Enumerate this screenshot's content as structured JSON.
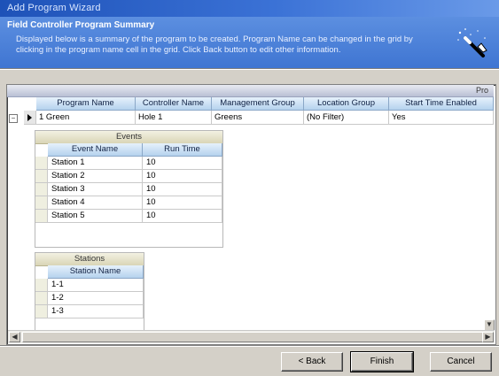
{
  "window": {
    "title": "Add Program Wizard"
  },
  "header": {
    "title": "Field Controller Program Summary",
    "description": "Displayed below is a summary of the program to be created.  Program Name can be changed in the grid by clicking in the program name cell in the grid.  Click Back button to edit other information.",
    "icon": "magic-wand-icon"
  },
  "grid": {
    "group_label": "Pro",
    "columns": [
      "Program Name",
      "Controller Name",
      "Management Group",
      "Location Group",
      "Start Time Enabled"
    ],
    "rows": [
      {
        "program": "1 Green",
        "controller": "Hole 1",
        "management": "Greens",
        "location": "(No Filter)",
        "start_time": "Yes"
      }
    ],
    "events": {
      "title": "Events",
      "columns": [
        "Event Name",
        "Run Time"
      ],
      "rows": [
        {
          "name": "Station 1",
          "run_time": "10"
        },
        {
          "name": "Station 2",
          "run_time": "10"
        },
        {
          "name": "Station 3",
          "run_time": "10"
        },
        {
          "name": "Station 4",
          "run_time": "10"
        },
        {
          "name": "Station 5",
          "run_time": "10"
        }
      ]
    },
    "stations": {
      "title": "Stations",
      "columns": [
        "Station Name"
      ],
      "rows": [
        "1-1",
        "1-2",
        "1-3"
      ]
    }
  },
  "buttons": {
    "back": "< Back",
    "finish": "Finish",
    "cancel": "Cancel"
  },
  "colors": {
    "title_bar": "#1e52b8",
    "header": "#3f75d2",
    "column_header": "#b5d2ee",
    "band_header": "#d9d5b6"
  }
}
